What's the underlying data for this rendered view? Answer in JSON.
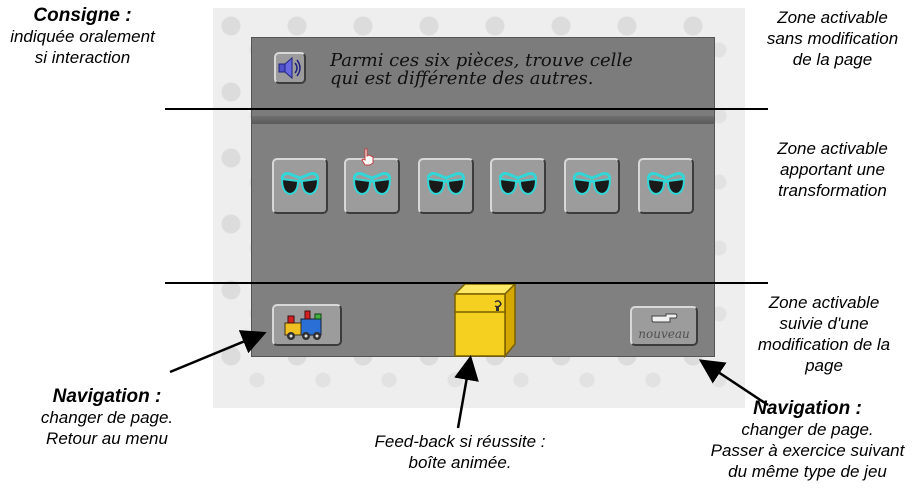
{
  "instruction": {
    "line1": "Parmi ces six pièces, trouve celle",
    "line2": "qui est différente des autres."
  },
  "pieces": [
    {
      "icon": "sunglasses-icon"
    },
    {
      "icon": "sunglasses-icon"
    },
    {
      "icon": "sunglasses-icon"
    },
    {
      "icon": "sunglasses-icon"
    },
    {
      "icon": "sunglasses-icon"
    },
    {
      "icon": "sunglasses-icon"
    }
  ],
  "nouveau_label": "nouveau",
  "annotations": {
    "consigne": {
      "title": "Consigne :",
      "lines": [
        "indiquée oralement",
        "si interaction"
      ]
    },
    "zone_sans_modif": {
      "lines": [
        "Zone activable",
        "sans modification",
        "de la page"
      ]
    },
    "zone_transformation": {
      "lines": [
        "Zone activable",
        "apportant une",
        "transformation"
      ]
    },
    "zone_modif_page": {
      "lines": [
        "Zone activable",
        "suivie d'une",
        "modification de la",
        "page"
      ]
    },
    "nav_menu": {
      "title": "Navigation :",
      "lines": [
        "changer de page.",
        "Retour au menu"
      ]
    },
    "feedback": {
      "lines": [
        "Feed-back si réussite :",
        "boîte animée."
      ]
    },
    "nav_suivant": {
      "title": "Navigation :",
      "lines": [
        "changer de page.",
        "Passer à exercice suivant",
        "du même type de jeu"
      ]
    }
  },
  "colors": {
    "panel": "#808080",
    "glasses_lens": "#1a1a1a",
    "glasses_frame": "#33d6d6",
    "box": "#f5d020"
  }
}
